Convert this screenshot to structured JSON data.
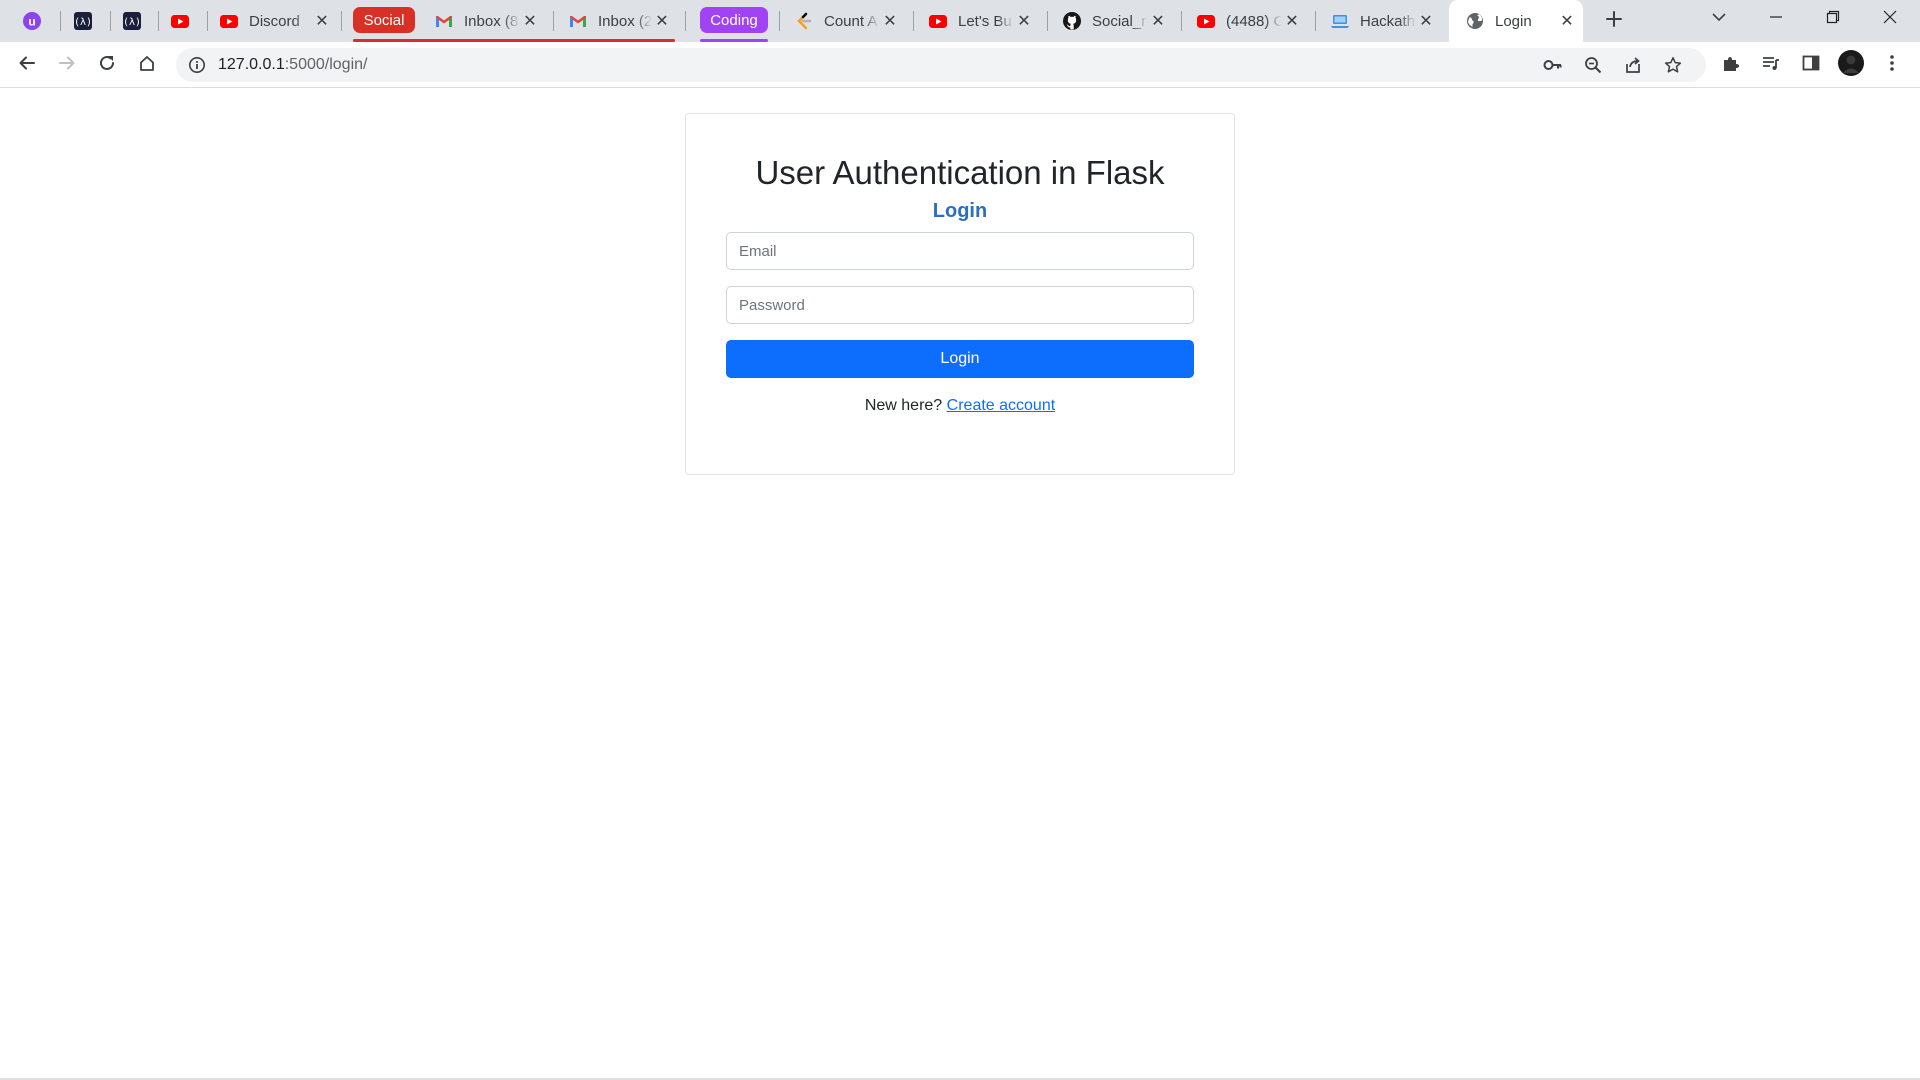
{
  "browser": {
    "tabs": [
      {
        "title": "",
        "icon": "u-circle-icon"
      },
      {
        "title": "",
        "icon": "code-logo-icon"
      },
      {
        "title": "",
        "icon": "code-logo-icon"
      },
      {
        "title": "",
        "icon": "youtube-icon"
      },
      {
        "title": "Discord",
        "icon": "youtube-icon"
      },
      {
        "title": "Inbox (8",
        "icon": "gmail-icon"
      },
      {
        "title": "Inbox (2",
        "icon": "gmail-icon"
      },
      {
        "title": "Count A",
        "icon": "leetcode-icon"
      },
      {
        "title": "Let's Bu",
        "icon": "youtube-icon"
      },
      {
        "title": "Social_n",
        "icon": "github-icon"
      },
      {
        "title": "(4488) C",
        "icon": "youtube-icon"
      },
      {
        "title": "Hackath",
        "icon": "laptop-icon"
      },
      {
        "title": "Login",
        "icon": "globe-icon"
      }
    ],
    "groups": [
      {
        "label": "Social",
        "color": "#d93025"
      },
      {
        "label": "Coding",
        "color": "#a142f4"
      }
    ],
    "address_bar": {
      "host": "127.0.0.1",
      "path": ":5000/login/"
    }
  },
  "page": {
    "title": "User Authentication in Flask",
    "subtitle": "Login",
    "email_placeholder": "Email",
    "password_placeholder": "Password",
    "login_button": "Login",
    "signup_prompt": "New here?",
    "signup_link": "Create account"
  },
  "colors": {
    "primary": "#0d6efd",
    "link": "#2c6fbb"
  }
}
